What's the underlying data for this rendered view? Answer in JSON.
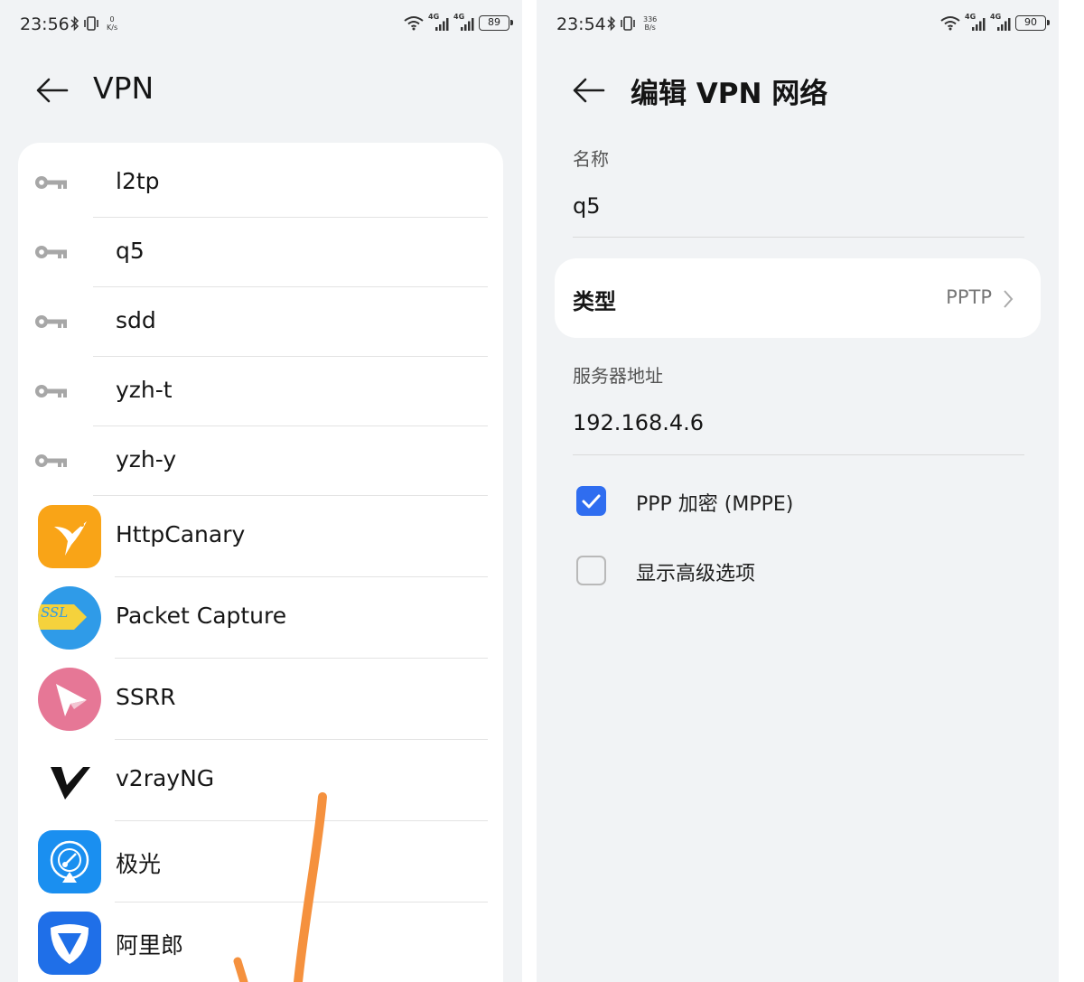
{
  "left_screen": {
    "status": {
      "time": "23:56",
      "speed_value": "0",
      "speed_unit": "K/s",
      "network_tag_1": "4G",
      "network_tag_2": "4G",
      "battery": "89"
    },
    "title": "VPN",
    "vpn_profiles": [
      {
        "label": "l2tp",
        "icon": "key-icon"
      },
      {
        "label": "q5",
        "icon": "key-icon"
      },
      {
        "label": "sdd",
        "icon": "key-icon"
      },
      {
        "label": "yzh-t",
        "icon": "key-icon"
      },
      {
        "label": "yzh-y",
        "icon": "key-icon"
      }
    ],
    "vpn_apps": [
      {
        "label": "HttpCanary",
        "icon": "httpcanary-bird-icon"
      },
      {
        "label": "Packet Capture",
        "icon": "packet-capture-ssl-icon"
      },
      {
        "label": "SSRR",
        "icon": "paper-plane-icon"
      },
      {
        "label": "v2rayNG",
        "icon": "v-logo-icon"
      },
      {
        "label": "极光",
        "icon": "jiguang-radar-icon"
      },
      {
        "label": "阿里郎",
        "icon": "alilang-shield-icon"
      }
    ]
  },
  "right_screen": {
    "status": {
      "time": "23:54",
      "speed_value": "336",
      "speed_unit": "B/s",
      "network_tag_1": "4G",
      "network_tag_2": "4G",
      "battery": "90"
    },
    "title": "编辑 VPN 网络",
    "name_label": "名称",
    "name_value": "q5",
    "type_label": "类型",
    "type_value": "PPTP",
    "server_label": "服务器地址",
    "server_value": "192.168.4.6",
    "ppp_encryption": {
      "label": "PPP 加密 (MPPE)",
      "checked": true
    },
    "advanced_options": {
      "label": "显示高级选项",
      "checked": false
    }
  },
  "colors": {
    "background": "#f1f3f5",
    "card": "#ffffff",
    "checkbox_accent": "#2f6df0",
    "annotation_stroke": "#f5913e",
    "httpcanary": "#f9a417",
    "packet_capture": "#2f9be8",
    "ssrr": "#e67796",
    "jiguang": "#1a8ff0",
    "alilang": "#1f6fe8"
  }
}
